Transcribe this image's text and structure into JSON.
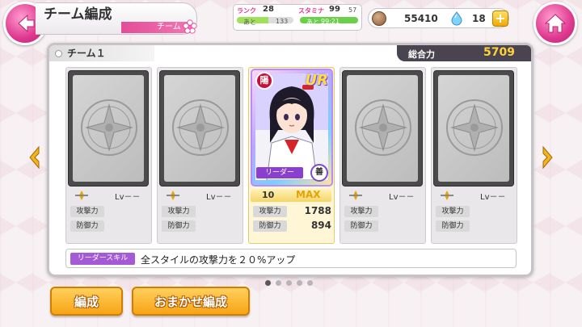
{
  "header": {
    "title": "チーム編成",
    "subtitle": "チーム"
  },
  "status": {
    "rank_label": "ランク",
    "rank_value": "28",
    "rank_next_label": "あと",
    "rank_next_value": "133",
    "stamina_label": "スタミナ",
    "stamina_value": "99",
    "stamina_max": "57",
    "stamina_time_label": "あと",
    "stamina_time": "99:21",
    "rank_progress": 0.55,
    "stamina_progress": 1.0
  },
  "currency": {
    "coins": "55410",
    "gems": "18",
    "add_label": "+"
  },
  "panel": {
    "team_label": "チーム１",
    "power_label": "総合力",
    "power_value": "5709"
  },
  "cards": [
    {
      "lv_label": "Lv－－",
      "atk_label": "攻撃力",
      "def_label": "防御力"
    },
    {
      "lv_label": "Lv－－",
      "atk_label": "攻撃力",
      "def_label": "防御力"
    },
    {
      "level": "10",
      "max_label": "MAX",
      "atk_label": "攻撃力",
      "atk_value": "1788",
      "def_label": "防御力",
      "def_value": "894",
      "rarity": "UR",
      "leader_tag": "リーダー",
      "element_badge": "陽",
      "school_badge": "善"
    },
    {
      "lv_label": "Lv－－",
      "atk_label": "攻撃力",
      "def_label": "防御力"
    },
    {
      "lv_label": "Lv－－",
      "atk_label": "攻撃力",
      "def_label": "防御力"
    }
  ],
  "leader_skill": {
    "label": "リーダースキル",
    "text": "全スタイルの攻撃力を２０%アップ"
  },
  "pagination": {
    "pages": 5,
    "current": 1
  },
  "buttons": {
    "edit": "編成",
    "auto": "おまかせ編成"
  },
  "colors": {
    "accent_pink": "#e0388f",
    "button_orange": "#f7a413",
    "power_plate": "#4a4450",
    "power_value": "#ffd23a",
    "leader_purple": "#8a3fd1"
  }
}
